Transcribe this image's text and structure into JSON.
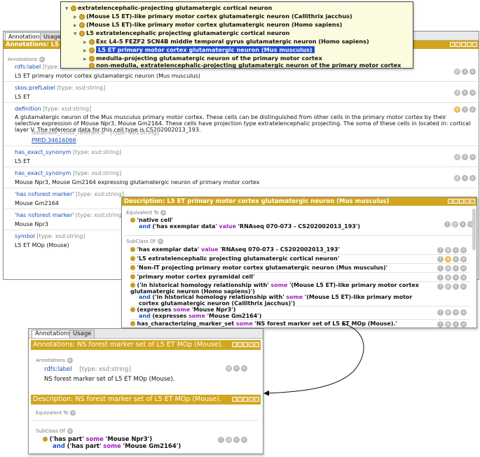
{
  "main": {
    "tabs": [
      "Annotations",
      "Usage"
    ],
    "title": "Annotations: L5 ET",
    "annotations_label": "Annotations",
    "rows": [
      {
        "prop": "rdfs:label",
        "type": "[type:",
        "value": "L5 ET primary motor cortex glutamatergic neuron (Mus musculus)"
      },
      {
        "prop": "skos:prefLabel",
        "type": "[type: xsd:string]",
        "value": "L5 ET"
      },
      {
        "prop": "definition",
        "type": "[type: xsd:string]",
        "value": "A glutamatergic neuron of the Mus musculus primary motor cortex. These cells can be distinguished from other cells in the primary motor cortex by their selective expression of Mouse Npr3, Mouse Gm2164. These cells have projection type extratelencephalic projecting. The soma of these cells in located in: cortical layer V. The reference data for this cell type is CS202002013_193.",
        "sub_prop": "database_cross_reference",
        "sub_type": "[type: xsd:string]",
        "sub_value": "PMID:34616066"
      },
      {
        "prop": "has_exact_synonym",
        "type": "[type: xsd:string]",
        "value": "L5 ET"
      },
      {
        "prop": "has_exact_synonym",
        "type": "[type: xsd:string]",
        "value": "Mouse Npr3, Mouse Gm2164 expressing glutamatergic neuron of primary motor cortex"
      },
      {
        "prop": "'has nsforest marker'",
        "type": "[type: xsd:string]",
        "value": "Mouse Gm2164"
      },
      {
        "prop": "'has nsforest marker'",
        "type": "[type: xsd:string]",
        "value": "Mouse Npr3"
      },
      {
        "prop": "symbol",
        "type": "[type: xsd:string]",
        "value": "L5 ET MOp (Mouse)"
      }
    ]
  },
  "tree": {
    "nodes": [
      {
        "label": "extratelencephalic-projecting glutamatergic cortical neuron",
        "depth": 0,
        "arrow": "▼"
      },
      {
        "label": "(Mouse L5 ET)-like primary motor cortex glutamatergic neuron (Callithrix jacchus)",
        "depth": 1,
        "arrow": "▶"
      },
      {
        "label": "(Mouse L5 ET)-like primary motor cortex glutamatergic neuron (Homo sapiens)",
        "depth": 1,
        "arrow": "▶"
      },
      {
        "label": "L5 extratelencephalic projecting glutamatergic cortical neuron",
        "depth": 1,
        "arrow": "▼"
      },
      {
        "label": "Exc L4-5 FEZF2 SCN4B middle temporal gyrus glutamatergic neuron (Homo sapiens)",
        "depth": 2,
        "arrow": "▶"
      },
      {
        "label": "L5 ET primary motor cortex glutamatergic neuron (Mus musculus)",
        "depth": 2,
        "arrow": "▶",
        "selected": true
      },
      {
        "label": "medulla-projecting glutamatergic neuron of the primary motor cortex",
        "depth": 2,
        "arrow": "▶"
      },
      {
        "label": "non-medulla, extratelencephalic-projecting glutamatergic neuron of the primary motor cortex",
        "depth": 2,
        "arrow": ""
      }
    ]
  },
  "description": {
    "title": "Description: L5 ET primary motor cortex glutamatergic neuron (Mus musculus)",
    "equivalent_to": "Equivalent To",
    "subclass_of": "SubClass Of",
    "equiv": {
      "line1": "'native cell'",
      "and": "and",
      "prop": "('has exemplar data'",
      "kw": "value",
      "val": "'RNAseq 070-073 - CS202002013_193')"
    },
    "subclasses": [
      {
        "a": "'has exemplar data'",
        "kw": "value",
        "b": "'RNAseq 070-073 - CS202002013_193'"
      },
      {
        "a": "'L5 extratelencephalic projecting glutamatergic cortical neuron'"
      },
      {
        "a": "'Non-IT projecting primary motor cortex glutamatergic neuron (Mus musculus)'"
      },
      {
        "a": "'primary motor cortex pyramidal cell'"
      },
      {
        "a": "('in historical homology relationship with'",
        "kw": "some",
        "b": "'(Mouse L5 ET)-like primary motor cortex glutamatergic neuron (Homo sapiens)')",
        "and": "and",
        "c": "('in historical homology relationship with'",
        "kw2": "some",
        "d": "'(Mouse L5 ET)-like primary motor cortex glutamatergic neuron (Callithrix jacchus)')"
      },
      {
        "a": "(expresses",
        "kw": "some",
        "b": "'Mouse Npr3')",
        "and": "and",
        "c": "(expresses",
        "kw2": "some",
        "d": "'Mouse Gm2164')"
      },
      {
        "a": "has_characterizing_marker_set",
        "kw": "some",
        "b": "'NS forest marker set of L5 ET MOp (Mouse).'"
      }
    ]
  },
  "ns": {
    "tabs": [
      "Annotations",
      "Usage"
    ],
    "ann_title": "Annotations: NS forest marker set of L5 ET MOp (Mouse).",
    "annotations_label": "Annotations",
    "prop": "rdfs:label",
    "type": "[type: xsd:string]",
    "value": "NS forest marker set of L5 ET MOp (Mouse).",
    "desc_title": "Description: NS forest marker set of L5 ET MOp (Mouse).",
    "equivalent_to": "Equivalent To",
    "subclass_of": "SubClass Of",
    "line1_a": "('has part'",
    "line1_kw": "some",
    "line1_b": "'Mouse Npr3')",
    "line2_and": "and",
    "line2_a": "('has part'",
    "line2_kw": "some",
    "line2_b": "'Mouse Gm2164')"
  }
}
